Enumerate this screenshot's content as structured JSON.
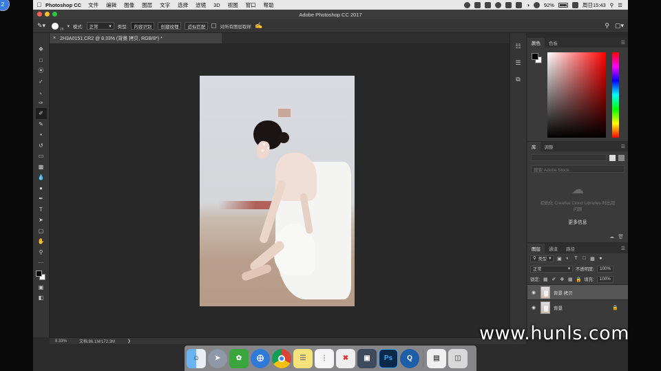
{
  "menubar": {
    "app_name": "Photoshop CC",
    "items": [
      "文件",
      "编辑",
      "图像",
      "图层",
      "文字",
      "选择",
      "滤镜",
      "3D",
      "视图",
      "窗口",
      "帮助"
    ],
    "battery": "92%",
    "clock": "周日15:43"
  },
  "window": {
    "title": "Adobe Photoshop CC 2017",
    "traffic_colors": [
      "#ff5f57",
      "#febc2e",
      "#28c840"
    ]
  },
  "options": {
    "brush_size": "28",
    "mode_label": "模式:",
    "mode_value": "正常",
    "type_label": "类型:",
    "type_buttons": [
      "内容识别",
      "创建纹理",
      "近似匹配"
    ],
    "sample_all_label": "对所有图层取样"
  },
  "document": {
    "tab_title": "2H3A0151.CR2 @ 8.33% (背景 拷贝, RGB/8*) *",
    "zoom": "8.33%",
    "doc_size": "文档:86.1M/172.3M"
  },
  "panels": {
    "color_tabs": [
      "颜色",
      "色板"
    ],
    "library_tabs": [
      "库",
      "调整"
    ],
    "library_search_placeholder": "搜索 Adobe Stock",
    "library_message": "初始化 Creative Cloud Libraries 时出现问题",
    "library_more": "更多信息",
    "layers_tabs": [
      "图层",
      "通道",
      "路径"
    ],
    "layer_filter": "类型",
    "blend_mode": "正常",
    "opacity_label": "不透明度:",
    "opacity_value": "100%",
    "lock_label": "锁定:",
    "fill_label": "填充:",
    "fill_value": "100%",
    "layers": [
      {
        "name": "背景 拷贝",
        "selected": true,
        "locked": false
      },
      {
        "name": "背景",
        "selected": false,
        "locked": true
      }
    ]
  },
  "dock": {
    "apps": [
      "finder-icon",
      "launchpad-icon",
      "evernote-icon",
      "safari-icon",
      "chrome-icon",
      "notes-icon",
      "reminders-icon",
      "xmind-icon",
      "screenshot-icon",
      "photoshop-icon",
      "quicktime-icon",
      "preview-icon",
      "trash-icon"
    ],
    "photoshop_label": "Ps"
  },
  "badge": "2",
  "watermark": "www.hunls.com"
}
